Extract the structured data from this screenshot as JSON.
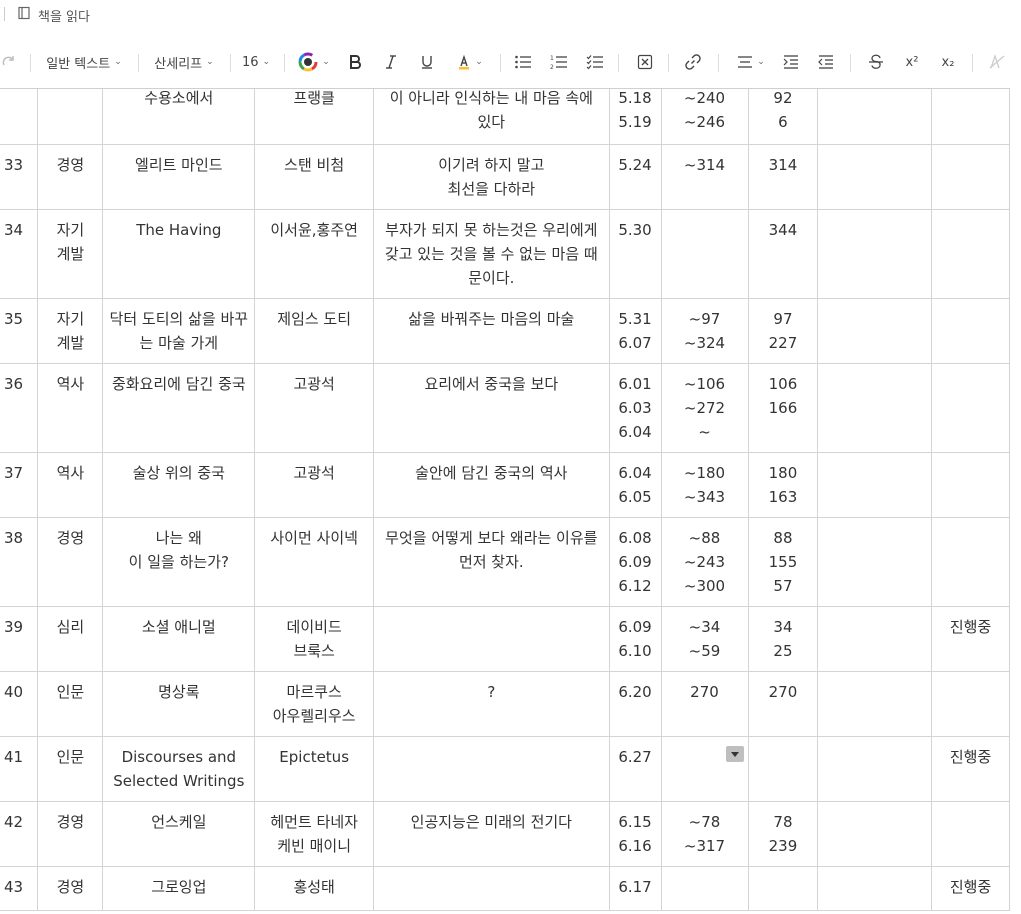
{
  "title": "책을 읽다",
  "toolbar": {
    "text_style": "일반 텍스트",
    "font": "산세리프",
    "font_size": "16",
    "superscript": "x²",
    "subscript": "x₂"
  },
  "rows": [
    {
      "no": "",
      "cat": "",
      "title": "수용소에서",
      "author": "프랭클",
      "note": "이 아니라 인식하는 내 마음 속에 있다",
      "dates": [
        "5.18",
        "5.19"
      ],
      "pages": [
        "~240",
        "~246"
      ],
      "counts": [
        "92",
        "6"
      ],
      "status": ""
    },
    {
      "no": "33",
      "cat": "경영",
      "title": "엘리트 마인드",
      "author": "스탠 비첨",
      "note": "이기려 하지 말고\n최선을 다하라",
      "dates": [
        "5.24"
      ],
      "pages": [
        "~314"
      ],
      "counts": [
        "314"
      ],
      "status": ""
    },
    {
      "no": "34",
      "cat": "자기계발",
      "title": "The Having",
      "author": "이서윤,홍주연",
      "note": "부자가 되지 못 하는것은 우리에게 갖고 있는 것을 볼 수 없는 마음 때문이다.",
      "dates": [
        "5.30"
      ],
      "pages": [],
      "counts": [
        "344"
      ],
      "status": ""
    },
    {
      "no": "35",
      "cat": "자기계발",
      "title": "닥터 도티의 삶을 바꾸는 마술 가게",
      "author": "제임스 도티",
      "note": "삶을 바꿔주는 마음의 마술",
      "dates": [
        "5.31",
        "6.07"
      ],
      "pages": [
        "~97",
        "~324"
      ],
      "counts": [
        "97",
        "227"
      ],
      "status": ""
    },
    {
      "no": "36",
      "cat": "역사",
      "title": "중화요리에 담긴 중국",
      "author": "고광석",
      "note": "요리에서 중국을 보다",
      "dates": [
        "6.01",
        "6.03",
        "6.04"
      ],
      "pages": [
        "~106",
        "~272",
        "~"
      ],
      "counts": [
        "106",
        "166"
      ],
      "status": ""
    },
    {
      "no": "37",
      "cat": "역사",
      "title": "술상 위의 중국",
      "author": "고광석",
      "note": "술안에 담긴 중국의 역사",
      "dates": [
        "6.04",
        "6.05"
      ],
      "pages": [
        "~180",
        "~343"
      ],
      "counts": [
        "180",
        "163"
      ],
      "status": ""
    },
    {
      "no": "38",
      "cat": "경영",
      "title": "나는 왜\n이 일을 하는가?",
      "author": "사이먼 사이넥",
      "note": "무엇을 어떻게 보다 왜라는 이유를 먼저 찾자.",
      "dates": [
        "6.08",
        "6.09",
        "6.12"
      ],
      "pages": [
        "~88",
        "~243",
        "~300"
      ],
      "counts": [
        "88",
        "155",
        "57"
      ],
      "status": ""
    },
    {
      "no": "39",
      "cat": "심리",
      "title": "소셜 애니멀",
      "author": "데이비드\n브룩스",
      "note": "",
      "dates": [
        "6.09",
        "6.10"
      ],
      "pages": [
        "~34",
        "~59"
      ],
      "counts": [
        "34",
        "25"
      ],
      "status": "진행중"
    },
    {
      "no": "40",
      "cat": "인문",
      "title": "명상록",
      "author": "마르쿠스\n아우렐리우스",
      "note": "?",
      "dates": [
        "6.20"
      ],
      "pages": [
        "270"
      ],
      "counts": [
        "270"
      ],
      "status": ""
    },
    {
      "no": "41",
      "cat": "인문",
      "title": "Discourses and Selected Writings",
      "author": "Epictetus",
      "note": "",
      "dates": [
        "6.27"
      ],
      "pages": [],
      "counts": [],
      "status": "진행중"
    },
    {
      "no": "42",
      "cat": "경영",
      "title": "언스케일",
      "author": "헤먼트 타네자\n케빈 매이니",
      "note": "인공지능은 미래의 전기다",
      "dates": [
        "6.15",
        "6.16"
      ],
      "pages": [
        "~78",
        "~317"
      ],
      "counts": [
        "78",
        "239"
      ],
      "status": ""
    },
    {
      "no": "43",
      "cat": "경영",
      "title": "그로잉업",
      "author": "홍성태",
      "note": "",
      "dates": [
        "6.17"
      ],
      "pages": [],
      "counts": [],
      "status": "진행중"
    }
  ]
}
